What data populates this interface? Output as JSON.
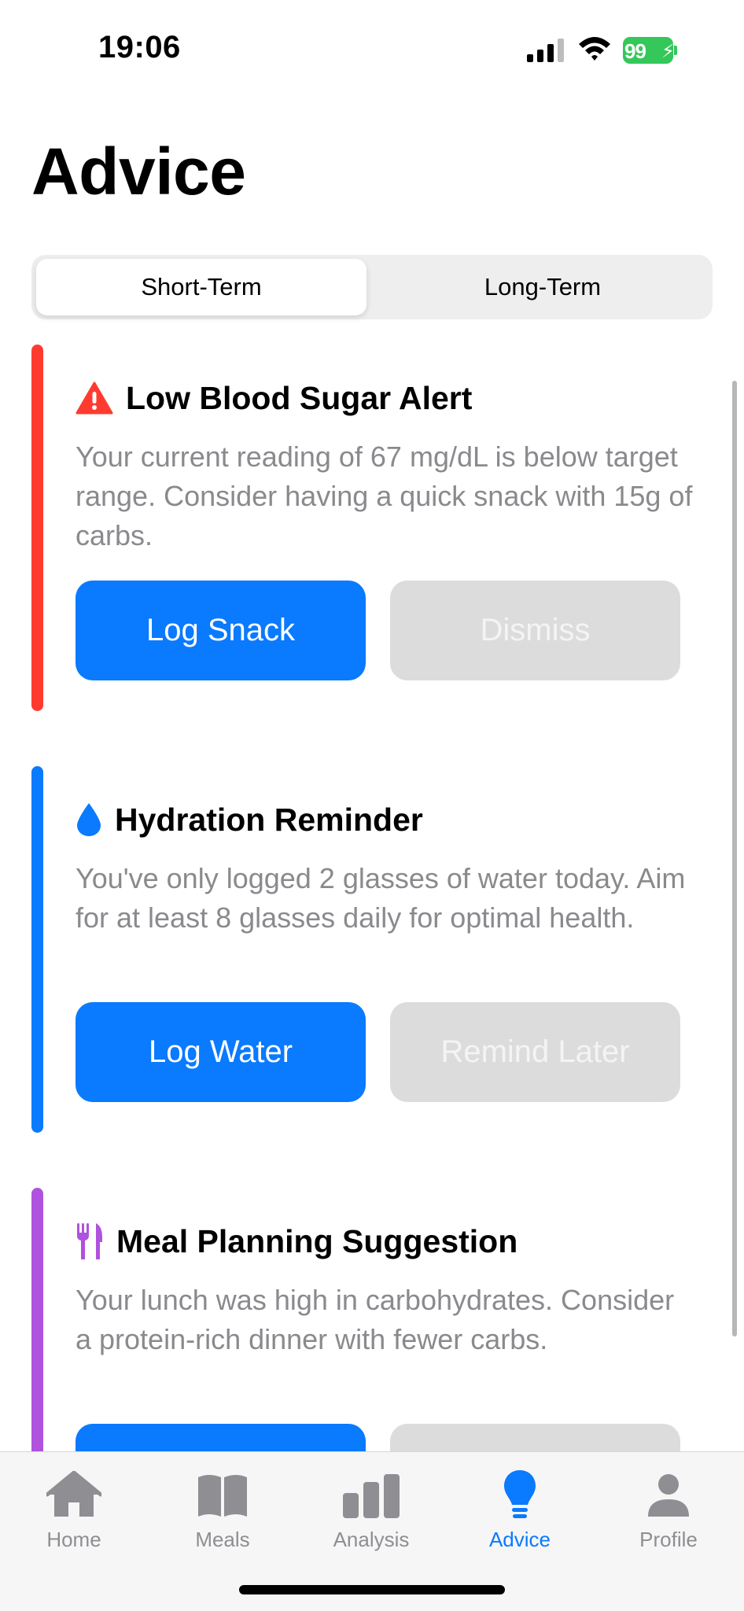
{
  "status_bar": {
    "time": "19:06",
    "battery": "99",
    "battery_color": "#34c759"
  },
  "page": {
    "title": "Advice"
  },
  "segmented": {
    "options": [
      "Short-Term",
      "Long-Term"
    ],
    "selected": "Short-Term"
  },
  "cards": [
    {
      "icon": "warning-triangle-icon",
      "accent": "#ff3b30",
      "title": "Low Blood Sugar Alert",
      "body": "Your current reading of 67 mg/dL is below target range. Consider having a quick snack with 15g of carbs.",
      "primary_action": "Log Snack",
      "secondary_action": "Dismiss"
    },
    {
      "icon": "water-drop-icon",
      "accent": "#0a7aff",
      "title": "Hydration Reminder",
      "body": "You've only logged 2 glasses of water today. Aim for at least 8 glasses daily for optimal health.",
      "primary_action": "Log Water",
      "secondary_action": "Remind Later"
    },
    {
      "icon": "fork-knife-icon",
      "accent": "#af52de",
      "title": "Meal Planning Suggestion",
      "body": "Your lunch was high in carbohydrates. Consider a protein-rich dinner with fewer carbs.",
      "primary_action": "",
      "secondary_action": ""
    }
  ],
  "tab_bar": {
    "tabs": [
      {
        "label": "Home",
        "icon": "house-icon"
      },
      {
        "label": "Meals",
        "icon": "book-icon"
      },
      {
        "label": "Analysis",
        "icon": "bar-chart-icon"
      },
      {
        "label": "Advice",
        "icon": "lightbulb-icon"
      },
      {
        "label": "Profile",
        "icon": "person-icon"
      }
    ],
    "active": "Advice",
    "active_color": "#0a7aff"
  }
}
